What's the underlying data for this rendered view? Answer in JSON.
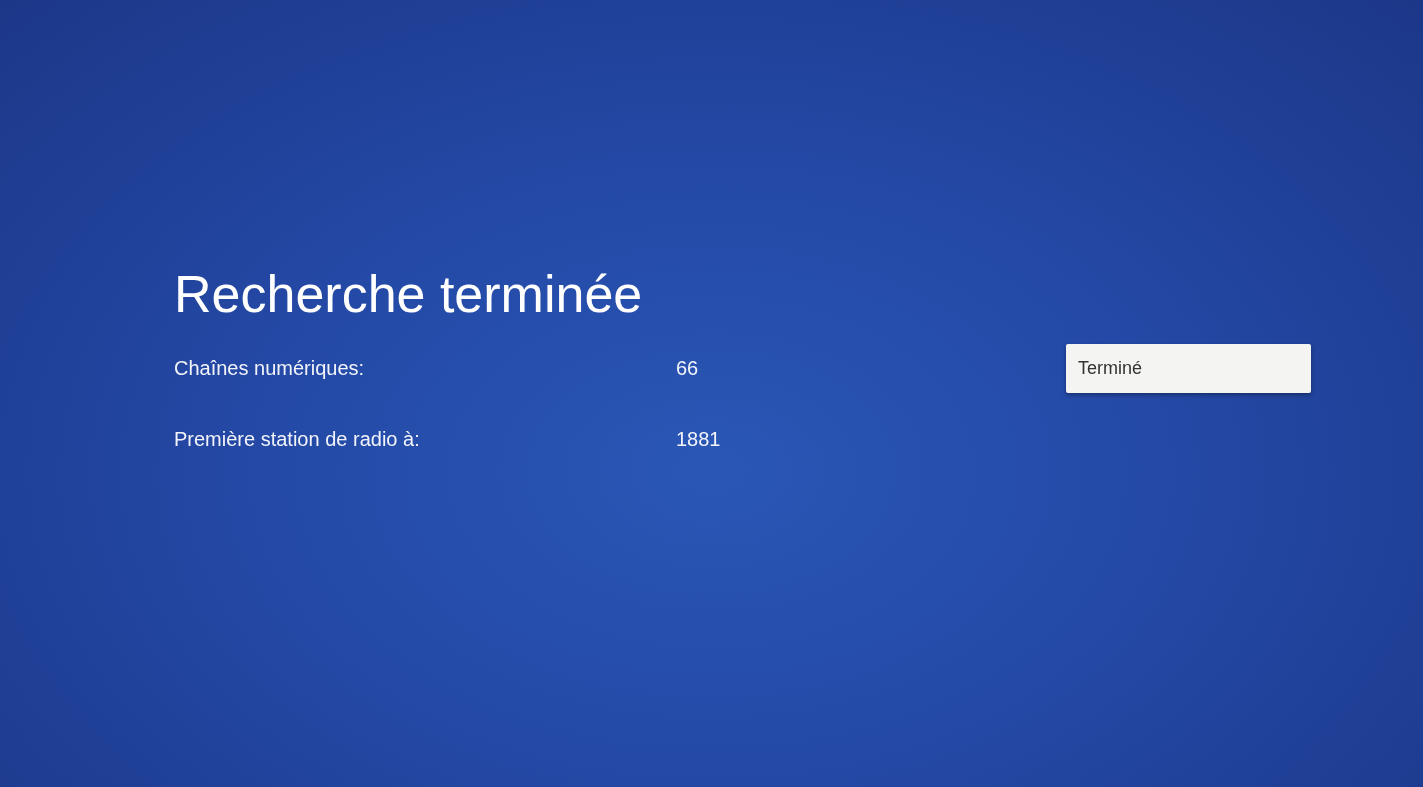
{
  "title": "Recherche terminée",
  "results": [
    {
      "label": "Chaînes numériques:",
      "value": "66"
    },
    {
      "label": "Première station de radio à:",
      "value": "1881"
    }
  ],
  "button": {
    "label": "Terminé"
  }
}
